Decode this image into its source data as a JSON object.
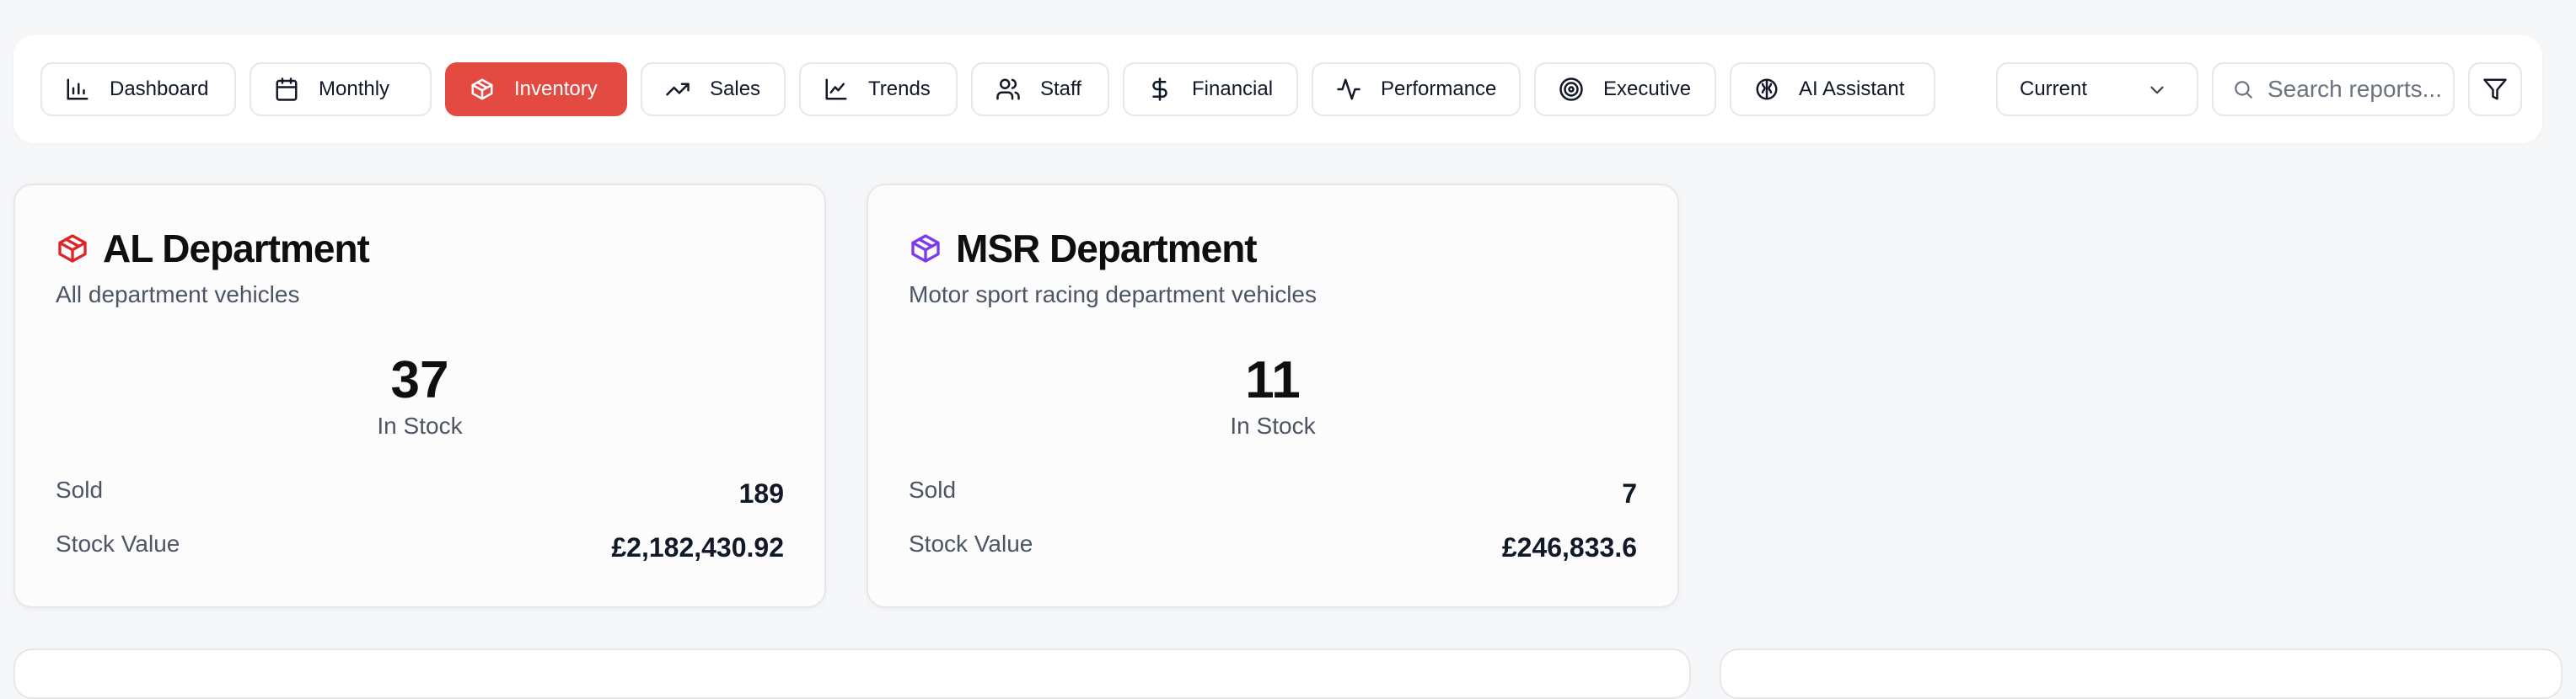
{
  "nav": {
    "tabs": [
      {
        "label": "Dashboard",
        "icon": "bar-chart-icon"
      },
      {
        "label": "Monthly",
        "icon": "calendar-icon"
      },
      {
        "label": "Inventory",
        "icon": "box-icon",
        "active": true
      },
      {
        "label": "Sales",
        "icon": "trending-up-icon"
      },
      {
        "label": "Trends",
        "icon": "line-chart-icon"
      },
      {
        "label": "Staff",
        "icon": "users-icon"
      },
      {
        "label": "Financial",
        "icon": "dollar-icon"
      },
      {
        "label": "Performance",
        "icon": "activity-icon"
      },
      {
        "label": "Executive",
        "icon": "target-icon"
      },
      {
        "label": "AI Assistant",
        "icon": "brain-icon"
      }
    ],
    "period_select": {
      "value": "Current"
    },
    "search": {
      "placeholder": "Search reports..."
    },
    "filter_icon": "filter-icon"
  },
  "colors": {
    "accent": "#e24a42",
    "al_icon": "#dc2626",
    "msr_icon": "#7c3aed"
  },
  "departments": [
    {
      "name": "AL Department",
      "description": "All department vehicles",
      "in_stock": "37",
      "in_stock_label": "In Stock",
      "sold_label": "Sold",
      "sold": "189",
      "stock_value_label": "Stock Value",
      "stock_value": "£2,182,430.92"
    },
    {
      "name": "MSR Department",
      "description": "Motor sport racing department vehicles",
      "in_stock": "11",
      "in_stock_label": "In Stock",
      "sold_label": "Sold",
      "sold": "7",
      "stock_value_label": "Stock Value",
      "stock_value": "£246,833.6"
    }
  ]
}
